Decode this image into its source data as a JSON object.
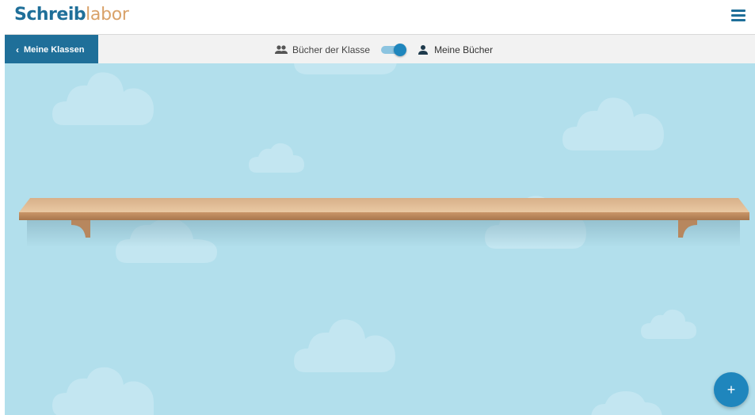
{
  "header": {
    "logo_main": "Schreib",
    "logo_accent": "labor",
    "menu_icon": "hamburger-menu-icon"
  },
  "subnav": {
    "back_label": "Meine Klassen",
    "class_books_label": "Bücher der Klasse",
    "my_books_label": "Meine Bücher",
    "toggle_state": "Meine Bücher"
  },
  "fab": {
    "label": "+"
  },
  "colors": {
    "brand": "#1f6f99",
    "accent": "#d9a26a",
    "sky": "#b2dfec",
    "fab": "#1f86bd"
  }
}
